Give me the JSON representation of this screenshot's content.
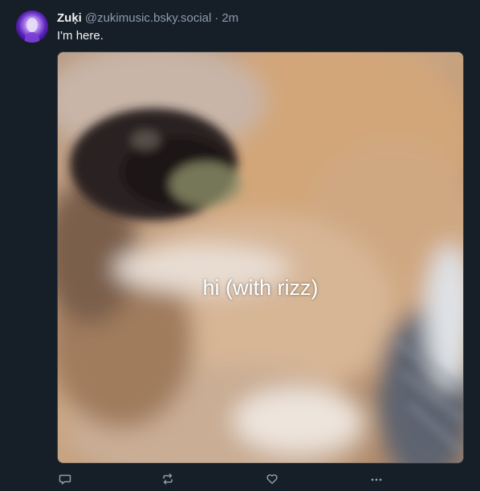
{
  "post": {
    "author": {
      "display_name": "Zuķi",
      "handle": "@zukimusic.bsky.social"
    },
    "separator": "·",
    "timestamp": "2m",
    "text": "I'm here.",
    "image": {
      "overlay_caption": "hi (with rizz)"
    },
    "actions": [
      {
        "icon": "reply-icon"
      },
      {
        "icon": "repost-icon"
      },
      {
        "icon": "like-icon"
      },
      {
        "icon": "more-icon"
      }
    ]
  },
  "colors": {
    "background": "#161e27",
    "text_primary": "#f1f3f5",
    "text_secondary": "#8c9cae",
    "icon": "#8c9cae"
  }
}
